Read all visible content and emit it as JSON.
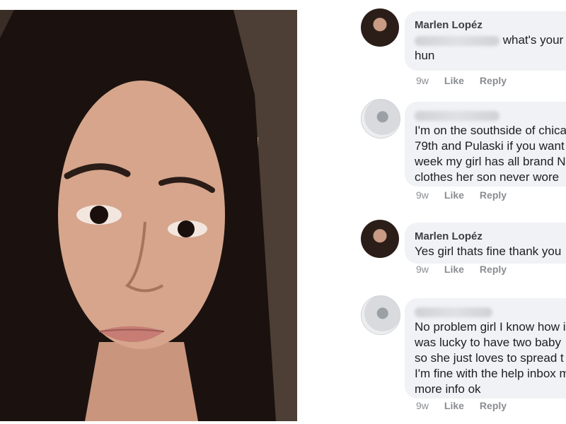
{
  "comments": [
    {
      "author": "Marlen Lopéz",
      "author_hidden": false,
      "text_prefix_hidden": true,
      "text": "what's your\nhun",
      "time": "9w",
      "like": "Like",
      "reply": "Reply"
    },
    {
      "author": "",
      "author_hidden": true,
      "text": "I'm on the southside of chica\n79th and Pulaski if you want\nweek my girl has all brand N\nclothes her son never wore",
      "time": "9w",
      "like": "Like",
      "reply": "Reply"
    },
    {
      "author": "Marlen Lopéz",
      "author_hidden": false,
      "text": "Yes girl thats fine thank you",
      "time": "9w",
      "like": "Like",
      "reply": "Reply"
    },
    {
      "author": "",
      "author_hidden": true,
      "text": "No problem girl I know how i\nwas lucky to have two baby\nso she just loves to spread t\nI'm fine with the help inbox m\nmore info ok",
      "time": "9w",
      "like": "Like",
      "reply": "Reply"
    }
  ],
  "colors": {
    "bubble": "#f0f2f5",
    "action_text": "#8a8d91"
  }
}
